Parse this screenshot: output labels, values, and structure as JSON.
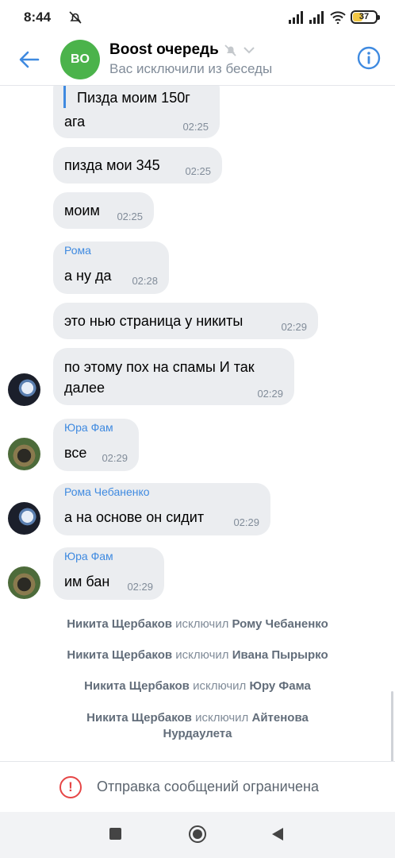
{
  "status": {
    "time": "8:44",
    "battery": "37"
  },
  "header": {
    "avatar_initials": "BO",
    "title": "Boost очередь",
    "subtitle": "Вас исключили из беседы"
  },
  "messages": [
    {
      "reply_text": "Пизда моим 150г",
      "text": "ага",
      "time": "02:25"
    },
    {
      "text": "пизда мои 345",
      "time": "02:25"
    },
    {
      "text": "моим",
      "time": "02:25"
    },
    {
      "sender": "Рома",
      "text": "а ну да",
      "time": "02:28"
    },
    {
      "text": "это нью страница у никиты",
      "time": "02:29"
    },
    {
      "text_line1": "по этому пох на спамы И так",
      "text_line2": "далее",
      "time": "02:29"
    },
    {
      "sender": "Юра Фам",
      "text": "все",
      "time": "02:29"
    },
    {
      "sender": "Рома Чебаненко",
      "text": "а на основе он сидит",
      "time": "02:29"
    },
    {
      "sender": "Юра Фам",
      "text": "им бан",
      "time": "02:29"
    }
  ],
  "system_messages": [
    {
      "actor": "Никита Щербаков",
      "action": "исключил",
      "target": "Рому Чебаненко"
    },
    {
      "actor": "Никита Щербаков",
      "action": "исключил",
      "target": "Ивана Пырырко"
    },
    {
      "actor": "Никита Щербаков",
      "action": "исключил",
      "target": "Юру Фама"
    },
    {
      "actor": "Никита Щербаков",
      "action": "исключил",
      "target": "Айтенова",
      "target_line2": "Нурдаулета"
    }
  ],
  "footer": {
    "restricted_text": "Отправка сообщений ограничена"
  },
  "colors": {
    "accent": "#3f8ae0",
    "bubble": "#ebedf0",
    "group_avatar": "#4bb34b",
    "warning": "#e64646"
  }
}
